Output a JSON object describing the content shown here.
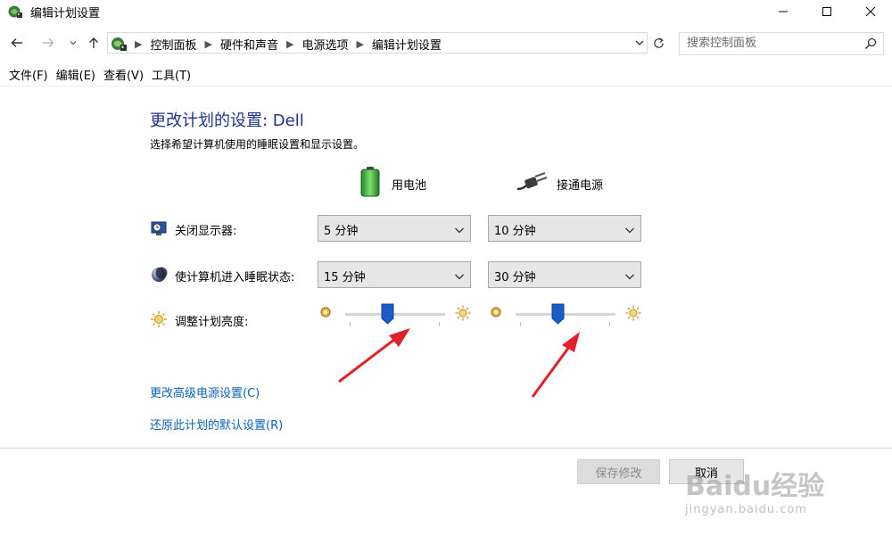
{
  "window": {
    "title": "编辑计划设置"
  },
  "address": {
    "crumbs": [
      "控制面板",
      "硬件和声音",
      "电源选项",
      "编辑计划设置"
    ]
  },
  "search": {
    "placeholder": "搜索控制面板"
  },
  "menu": {
    "items": [
      "文件(F)",
      "编辑(E)",
      "查看(V)",
      "工具(T)"
    ]
  },
  "page": {
    "title": "更改计划的设置: Dell",
    "subtitle": "选择希望计算机使用的睡眠设置和显示设置。"
  },
  "columns": {
    "battery": "用电池",
    "plugged": "接通电源"
  },
  "rows": {
    "display": {
      "label": "关闭显示器:",
      "battery_value": "5 分钟",
      "plugged_value": "10 分钟"
    },
    "sleep": {
      "label": "使计算机进入睡眠状态:",
      "battery_value": "15 分钟",
      "plugged_value": "30 分钟"
    },
    "brightness": {
      "label": "调整计划亮度:",
      "battery_level": 0.42,
      "plugged_level": 0.42
    }
  },
  "links": {
    "advanced": "更改高级电源设置(C)",
    "restore": "还原此计划的默认设置(R)"
  },
  "buttons": {
    "save": "保存修改",
    "cancel": "取消"
  },
  "watermark": {
    "logo": "Baidu经验",
    "url": "jingyan.baidu.com"
  },
  "colors": {
    "title": "#1e3287",
    "link": "#0b62b3",
    "slider_thumb": "#1a5dc8",
    "annotation_arrow": "#e0202a"
  }
}
